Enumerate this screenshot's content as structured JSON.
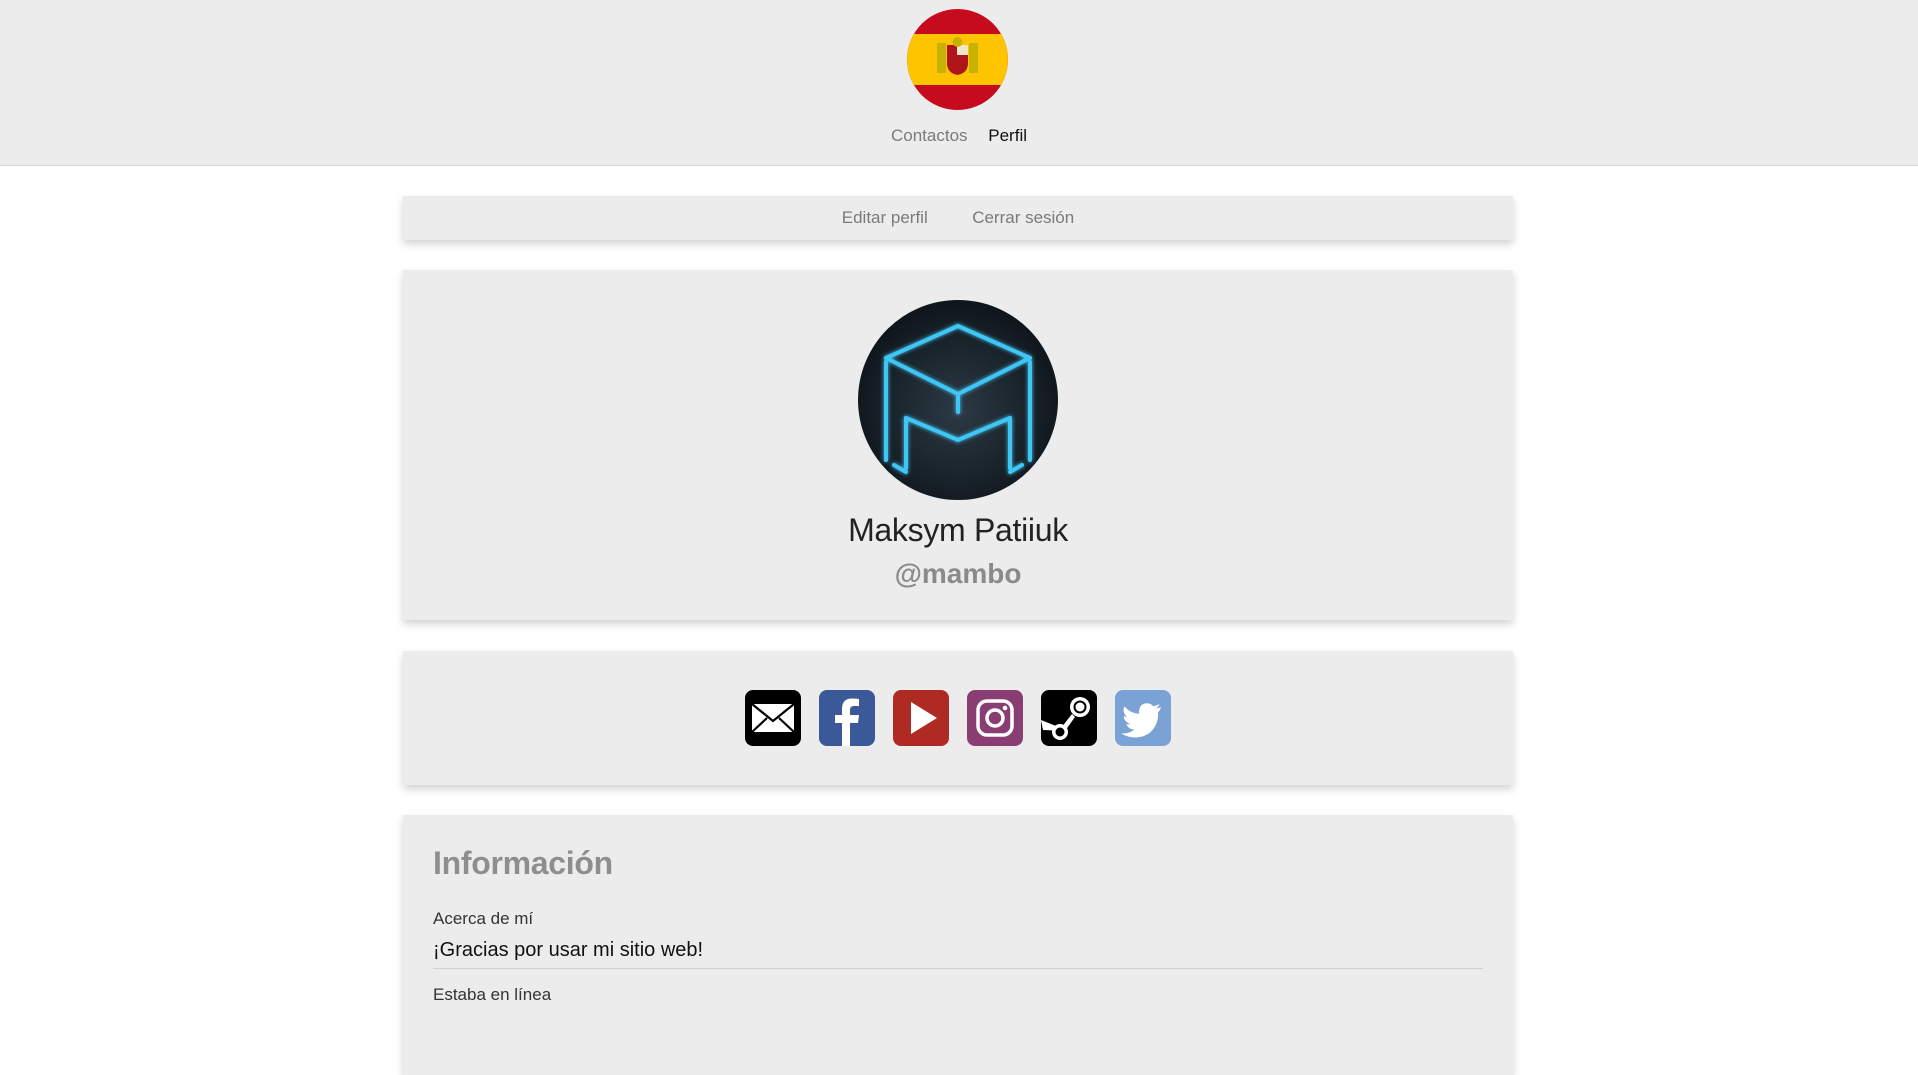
{
  "header": {
    "flag_icon": "spain-flag-icon",
    "nav": [
      {
        "label": "Contactos",
        "active": false
      },
      {
        "label": "Perfil",
        "active": true
      }
    ]
  },
  "actions": {
    "edit_label": "Editar perfil",
    "logout_label": "Cerrar sesión"
  },
  "profile": {
    "avatar_icon": "neon-cube-m-logo",
    "name": "Maksym Patiiuk",
    "username": "@mambo"
  },
  "social": [
    {
      "name": "email-icon",
      "color": "#000000"
    },
    {
      "name": "facebook-icon",
      "color": "#3b5998"
    },
    {
      "name": "youtube-icon",
      "color": "#b02a24"
    },
    {
      "name": "instagram-icon",
      "color": "#8a3d73"
    },
    {
      "name": "steam-icon",
      "color": "#000000"
    },
    {
      "name": "twitter-icon",
      "color": "#7aa2d4"
    }
  ],
  "info": {
    "title": "Información",
    "fields": [
      {
        "label": "Acerca de mí",
        "value": "¡Gracias por usar mi sitio web!"
      },
      {
        "label": "Estaba en línea",
        "value": ""
      }
    ]
  }
}
